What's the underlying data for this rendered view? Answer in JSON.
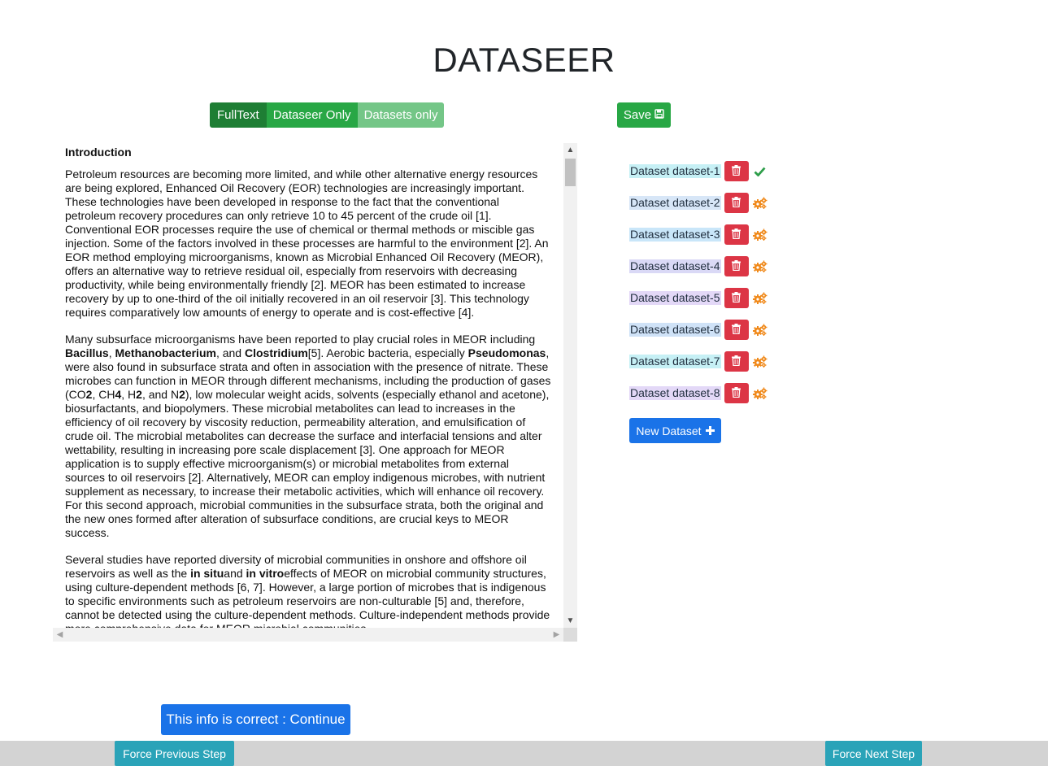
{
  "app": {
    "title": "DATASEER"
  },
  "view_modes": [
    {
      "label": "FullText",
      "active": true
    },
    {
      "label": "Dataseer Only",
      "active": false
    },
    {
      "label": "Datasets only",
      "active": false
    }
  ],
  "toolbar": {
    "save_label": "Save",
    "save_icon": "floppy-disk-icon"
  },
  "document": {
    "heading": "Introduction",
    "paragraphs": [
      [
        {
          "t": "Petroleum resources are becoming more limited, and while other alternative energy resources are being explored, Enhanced Oil Recovery (EOR) technologies are increasingly important. These technologies have been developed in response to the fact that the conventional petroleum recovery procedures can only retrieve 10 to 45 percent of the crude oil [1]. Conventional EOR processes require the use of chemical or thermal methods or miscible gas injection. Some of the factors involved in these processes are harmful to the environment [2]. An EOR method employing microorganisms, known as Microbial Enhanced Oil Recovery (MEOR), offers an alternative way to retrieve residual oil, especially from reservoirs with decreasing productivity, while being environmentally friendly [2]. MEOR has been estimated to increase recovery by up to one-third of the oil initially recovered in an oil reservoir [3]. This technology requires comparatively low amounts of energy to operate and is cost-effective [4].",
          "b": false
        }
      ],
      [
        {
          "t": "Many subsurface microorganisms have been reported to play crucial roles in MEOR including ",
          "b": false
        },
        {
          "t": "Bacillus",
          "b": true
        },
        {
          "t": ", ",
          "b": false
        },
        {
          "t": "Methanobacterium",
          "b": true
        },
        {
          "t": ", and ",
          "b": false
        },
        {
          "t": "Clostridium",
          "b": true
        },
        {
          "t": "[5]. Aerobic bacteria, especially ",
          "b": false
        },
        {
          "t": "Pseudomonas",
          "b": true
        },
        {
          "t": ", were also found in subsurface strata and often in association with the presence of nitrate. These microbes can function in MEOR through different mechanisms, including the production of gases (CO",
          "b": false
        },
        {
          "t": "2",
          "b": true
        },
        {
          "t": ", CH",
          "b": false
        },
        {
          "t": "4",
          "b": true
        },
        {
          "t": ", H",
          "b": false
        },
        {
          "t": "2",
          "b": true
        },
        {
          "t": ", and N",
          "b": false
        },
        {
          "t": "2",
          "b": true
        },
        {
          "t": "), low molecular weight acids, solvents (especially ethanol and acetone), biosurfactants, and biopolymers. These microbial metabolites can lead to increases in the efficiency of oil recovery by viscosity reduction, permeability alteration, and emulsification of crude oil. The microbial metabolites can decrease the surface and interfacial tensions and alter wettability, resulting in increasing pore scale displacement [3]. One approach for MEOR application is to supply effective microorganism(s) or microbial metabolites from external sources to oil reservoirs [2]. Alternatively, MEOR can employ indigenous microbes, with nutrient supplement as necessary, to increase their metabolic activities, which will enhance oil recovery. For this second approach, microbial communities in the subsurface strata, both the original and the new ones formed after alteration of subsurface conditions, are crucial keys to MEOR success.",
          "b": false
        }
      ],
      [
        {
          "t": "Several studies have reported diversity of microbial communities in onshore and offshore oil reservoirs as well as the ",
          "b": false
        },
        {
          "t": "in situ",
          "b": true
        },
        {
          "t": "and ",
          "b": false
        },
        {
          "t": "in vitro",
          "b": true
        },
        {
          "t": "effects of MEOR on microbial community structures, using culture-dependent methods [6, 7]. However, a large portion of microbes that is indigenous to specific environments such as petroleum reservoirs are non-culturable [5] and, therefore, cannot be detected using the culture-dependent methods. Culture-independent methods provide more comprehensive data for MEOR microbial communities",
          "b": false
        }
      ]
    ]
  },
  "datasets": [
    {
      "label": "Dataset dataset-1",
      "highlight": "#c6f0f5",
      "status": "validated",
      "status_icon": "checkmark-icon",
      "delete_icon": "trash-icon"
    },
    {
      "label": "Dataset dataset-2",
      "highlight": "#d7e6f7",
      "status": "pending",
      "status_icon": "gears-icon",
      "delete_icon": "trash-icon"
    },
    {
      "label": "Dataset dataset-3",
      "highlight": "#c9e6f9",
      "status": "pending",
      "status_icon": "gears-icon",
      "delete_icon": "trash-icon"
    },
    {
      "label": "Dataset dataset-4",
      "highlight": "#dad9f6",
      "status": "pending",
      "status_icon": "gears-icon",
      "delete_icon": "trash-icon"
    },
    {
      "label": "Dataset dataset-5",
      "highlight": "#e3d8f7",
      "status": "pending",
      "status_icon": "gears-icon",
      "delete_icon": "trash-icon"
    },
    {
      "label": "Dataset dataset-6",
      "highlight": "#cfe2f7",
      "status": "pending",
      "status_icon": "gears-icon",
      "delete_icon": "trash-icon"
    },
    {
      "label": "Dataset dataset-7",
      "highlight": "#c6f0f5",
      "status": "pending",
      "status_icon": "gears-icon",
      "delete_icon": "trash-icon"
    },
    {
      "label": "Dataset dataset-8",
      "highlight": "#e3d8f7",
      "status": "pending",
      "status_icon": "gears-icon",
      "delete_icon": "trash-icon"
    }
  ],
  "new_dataset": {
    "label": "New Dataset",
    "icon": "plus-icon"
  },
  "actions": {
    "continue_label": "This info is correct : Continue",
    "force_previous_label": "Force Previous Step",
    "force_next_label": "Force Next Step"
  },
  "colors": {
    "success": "#28a745",
    "success_dark": "#1e7e34",
    "danger": "#dc3545",
    "primary": "#1a73e8",
    "info": "#2aa3b8",
    "warning_icon": "#f0891a"
  }
}
